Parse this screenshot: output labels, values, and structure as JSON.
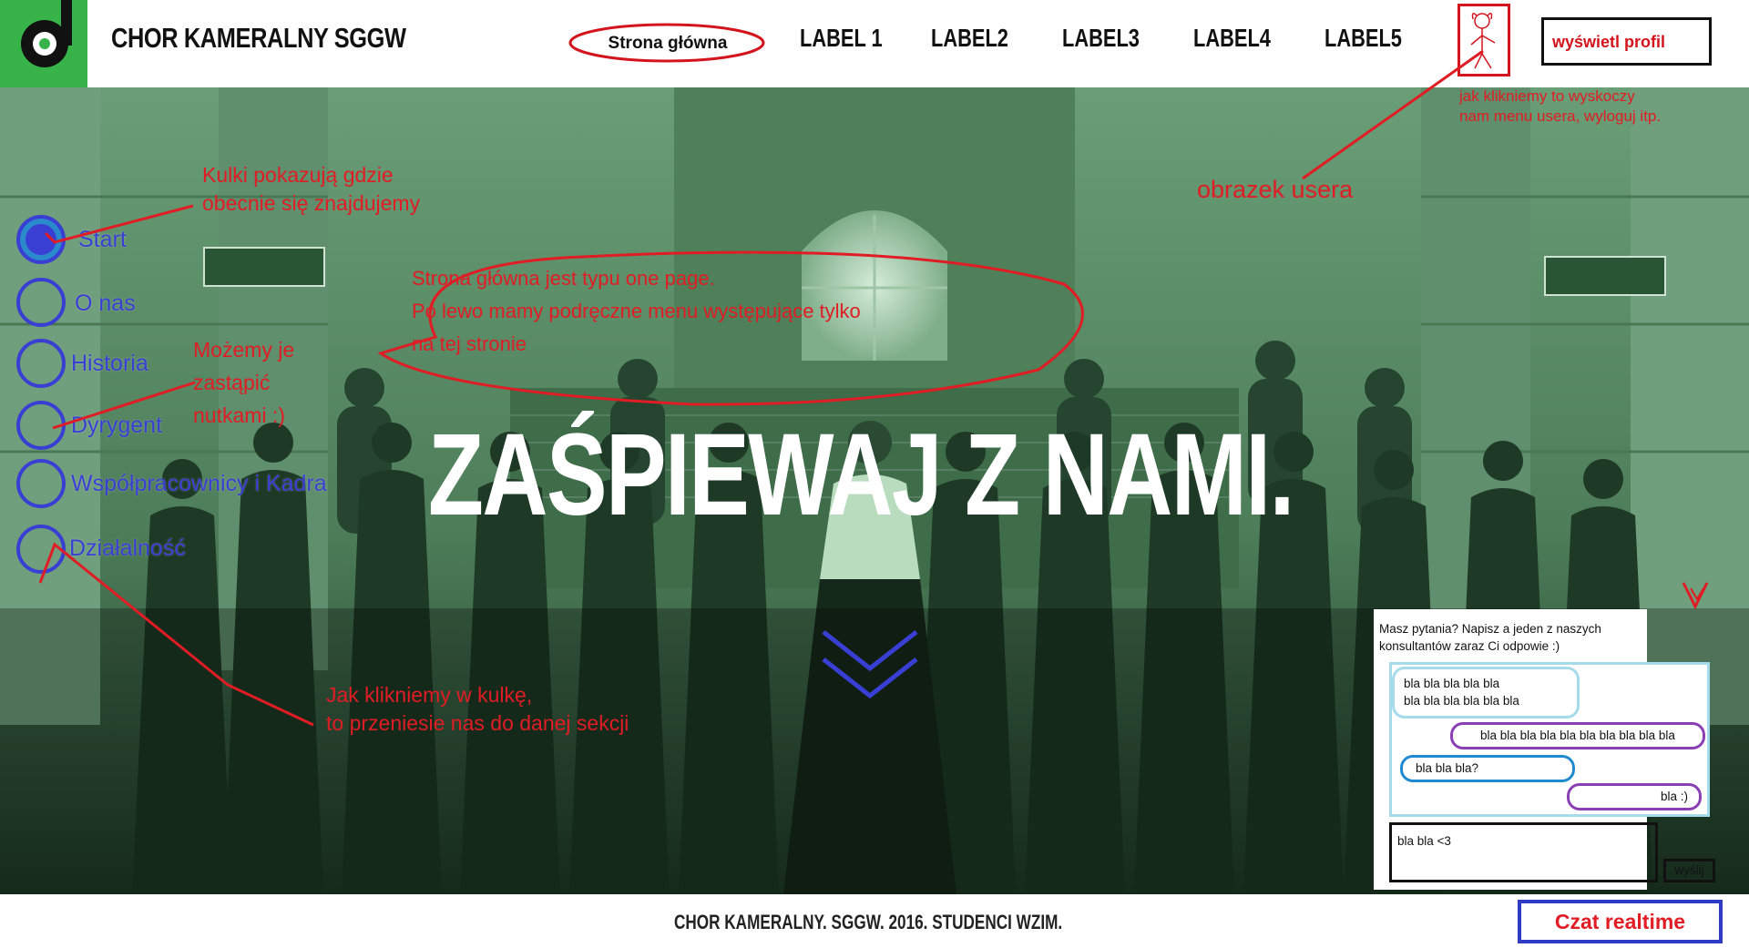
{
  "header": {
    "brand": "CHOR KAMERALNY SGGW",
    "nav": {
      "home": "Strona główna",
      "items": [
        "LABEL 1",
        "LABEL2",
        "LABEL3",
        "LABEL4",
        "LABEL5"
      ]
    },
    "profile_button": "wyświetl profil"
  },
  "hero": {
    "title": "ZAŚPIEWAJ Z NAMI."
  },
  "side_menu": {
    "items": [
      {
        "label": "Start",
        "active": true
      },
      {
        "label": "O nas",
        "active": false
      },
      {
        "label": "Historia",
        "active": false
      },
      {
        "label": "Dyrygent",
        "active": false
      },
      {
        "label": "Współpracownicy i Kadra",
        "active": false
      },
      {
        "label": "Działalność",
        "active": false
      }
    ]
  },
  "annotations": {
    "user_menu": [
      "jak klikniemy to wyskoczy",
      "nam menu usera, wyloguj itp."
    ],
    "user_image": "obrazek usera",
    "dots": [
      "Kulki pokazują gdzie",
      "obecnie się znajdujemy"
    ],
    "one_page": [
      "Strona główna jest typu one page.",
      "Po lewo mamy podręczne menu występujące tylko",
      "na tej stronie"
    ],
    "notes": [
      "Możemy je",
      "zastąpić",
      "nutkami :)"
    ],
    "click_dot": [
      "Jak klikniemy w kulkę,",
      "to przeniesie nas do danej sekcji"
    ]
  },
  "chat": {
    "intro": "Masz pytania? Napisz a jeden z naszych konsultantów zaraz Ci odpowie :)",
    "messages": [
      {
        "lines": [
          "bla bla bla bla bla",
          "bla bla bla bla bla bla"
        ],
        "side": "left",
        "color": "#a6dbec"
      },
      {
        "lines": [
          "bla bla bla bla bla bla bla bla bla bla"
        ],
        "side": "right",
        "color": "#8b3fb5"
      },
      {
        "lines": [
          "bla bla bla?"
        ],
        "side": "left",
        "color": "#1f8ad0"
      },
      {
        "lines": [
          "bla :)"
        ],
        "side": "right",
        "color": "#8b3fb5"
      }
    ],
    "input_value": "bla bla <3",
    "send_label": "wyślij"
  },
  "footer": {
    "text": "CHOR KAMERALNY. SGGW. 2016. STUDENCI WZIM.",
    "chat_button": "Czat realtime"
  },
  "colors": {
    "accent_green": "#37b34a",
    "annotation_red": "#e01c24",
    "menu_blue": "#3a3fd4"
  }
}
